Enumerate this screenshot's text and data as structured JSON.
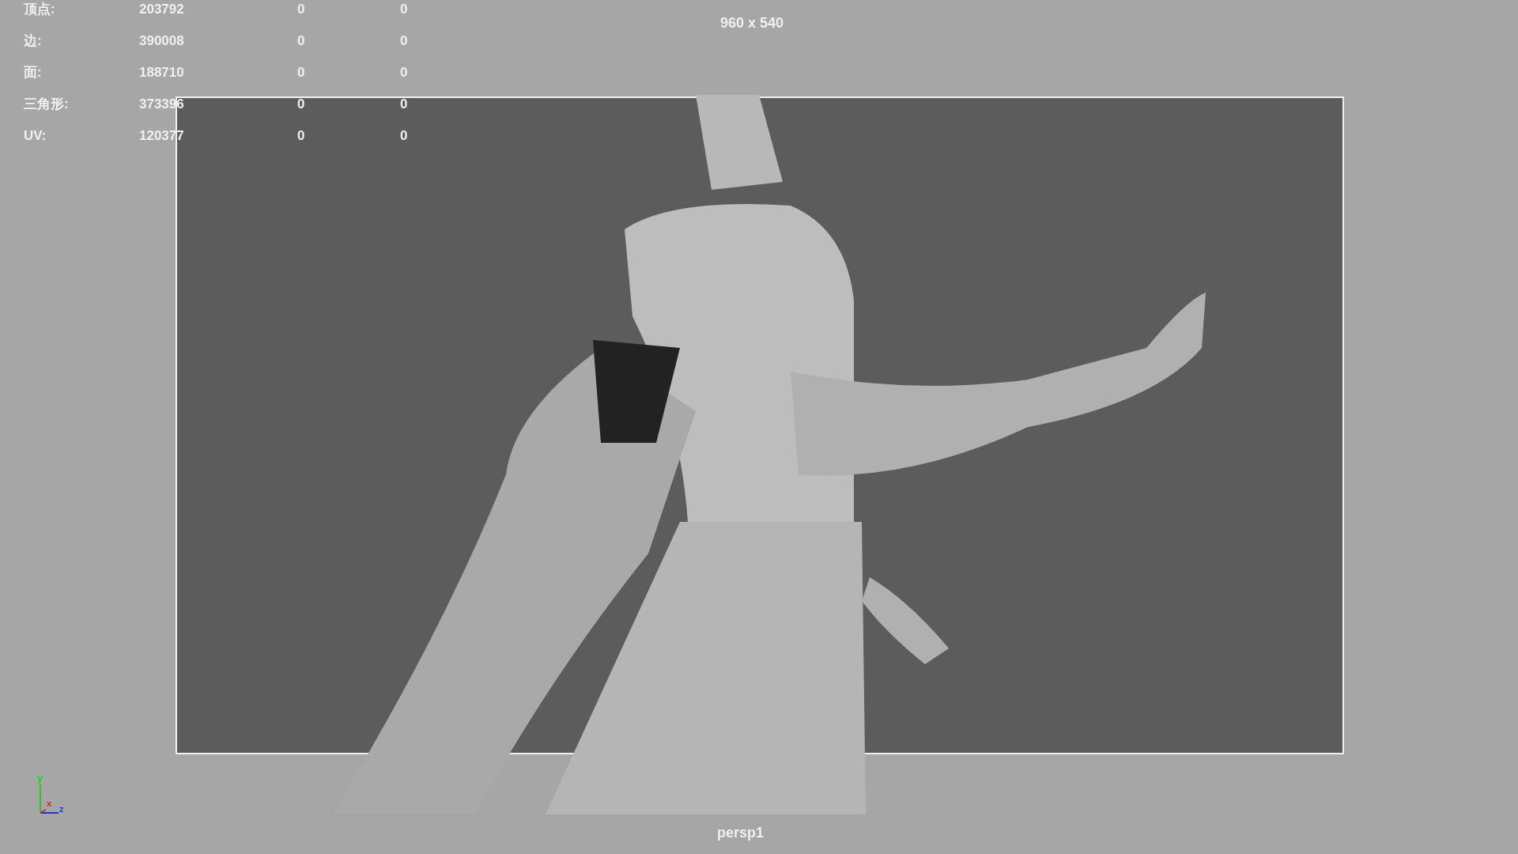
{
  "viewport": {
    "resolution": "960 x 540",
    "camera": "persp1",
    "stats": [
      {
        "label": "顶点:",
        "values": [
          "203792",
          "0",
          "0"
        ]
      },
      {
        "label": "边:",
        "values": [
          "390008",
          "0",
          "0"
        ]
      },
      {
        "label": "面:",
        "values": [
          "188710",
          "0",
          "0"
        ]
      },
      {
        "label": "三角形:",
        "values": [
          "373396",
          "0",
          "0"
        ]
      },
      {
        "label": "UV:",
        "values": [
          "120377",
          "0",
          "0"
        ]
      }
    ],
    "axis_labels": [
      "y",
      "x",
      "z"
    ]
  }
}
